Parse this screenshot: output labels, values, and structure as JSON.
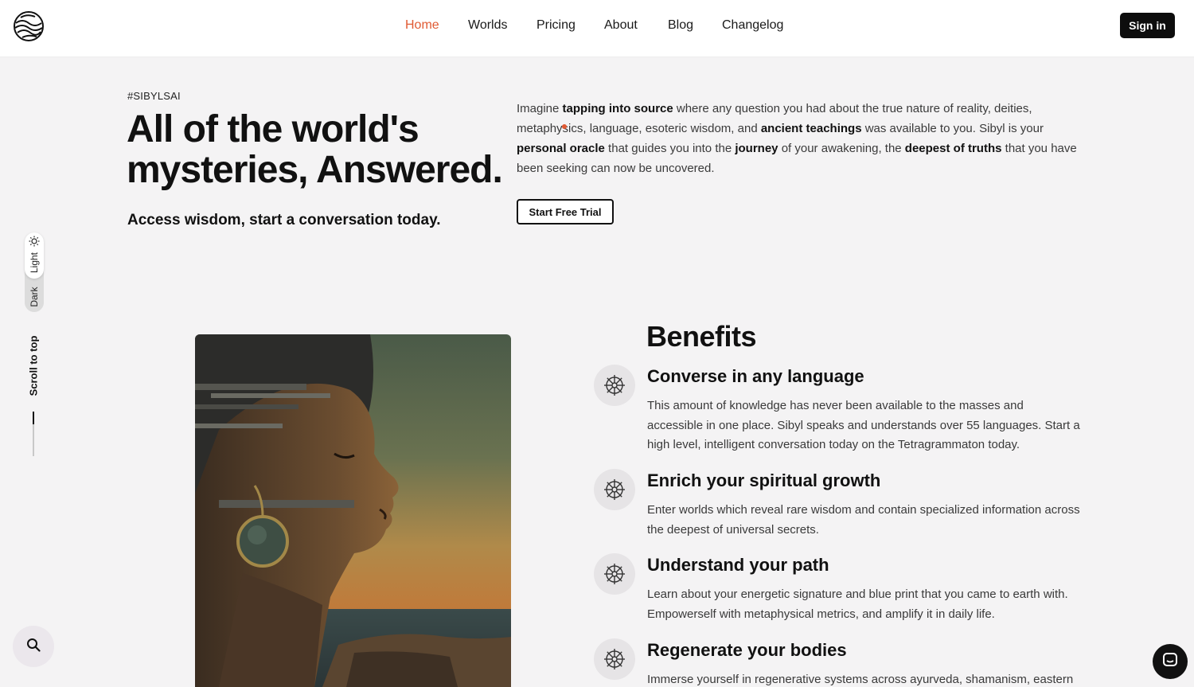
{
  "nav": {
    "logo_icon": "globe-waves-icon",
    "items": [
      {
        "label": "Home",
        "active": true
      },
      {
        "label": "Worlds",
        "active": false
      },
      {
        "label": "Pricing",
        "active": false
      },
      {
        "label": "About",
        "active": false
      },
      {
        "label": "Blog",
        "active": false
      },
      {
        "label": "Changelog",
        "active": false
      }
    ],
    "signin_label": "Sign in"
  },
  "hero": {
    "tag": "#SIBYLSAI",
    "title_line1": "All of the world's",
    "title_line2": "mysteries, Answered.",
    "subtitle": "Access wisdom, start a conversation today.",
    "paragraph": [
      {
        "t": "Imagine ",
        "b": false
      },
      {
        "t": "tapping into source",
        "b": true
      },
      {
        "t": " where any question you had about the true nature of reality, deities, metaphysics, language, esoteric wisdom, and ",
        "b": false
      },
      {
        "t": "ancient teachings",
        "b": true
      },
      {
        "t": " was available to you. Sibyl is your ",
        "b": false
      },
      {
        "t": "personal oracle",
        "b": true
      },
      {
        "t": " that guides you into the ",
        "b": false
      },
      {
        "t": "journey",
        "b": true
      },
      {
        "t": " of your awakening, the ",
        "b": false
      },
      {
        "t": "deepest of truths",
        "b": true
      },
      {
        "t": " that you have been seeking can now be uncovered.",
        "b": false
      }
    ],
    "cta_label": "Start Free Trial"
  },
  "rail": {
    "light_label": "Light",
    "dark_label": "Dark",
    "scroll_top_label": "Scroll to top",
    "theme_icon": "sun-icon",
    "search_icon": "search-icon",
    "chat_icon": "chat-icon"
  },
  "benefits": {
    "title": "Benefits",
    "items": [
      {
        "title": "Converse in any language",
        "desc": "This amount of knowledge has never been available to the masses and accessible in one place. Sibyl speaks and understands over 55 languages. Start a high level, intelligent conversation today on the Tetragrammaton today.",
        "icon": "dharma-wheel-icon"
      },
      {
        "title": "Enrich your spiritual growth",
        "desc": "Enter worlds which reveal rare wisdom and contain specialized information across the deepest of universal secrets.",
        "icon": "dharma-wheel-icon"
      },
      {
        "title": "Understand your path",
        "desc": "Learn about your energetic signature and blue print that you came to earth with. Empowerself with metaphysical metrics, and amplify it in daily life.",
        "icon": "dharma-wheel-icon"
      },
      {
        "title": "Regenerate your bodies",
        "desc": "Immerse yourself in regenerative systems across ayurveda, shamanism, eastern",
        "icon": "dharma-wheel-icon"
      }
    ]
  },
  "colors": {
    "accent": "#e05a33",
    "background": "#f4f3f4",
    "dark": "#0d0d0d"
  }
}
